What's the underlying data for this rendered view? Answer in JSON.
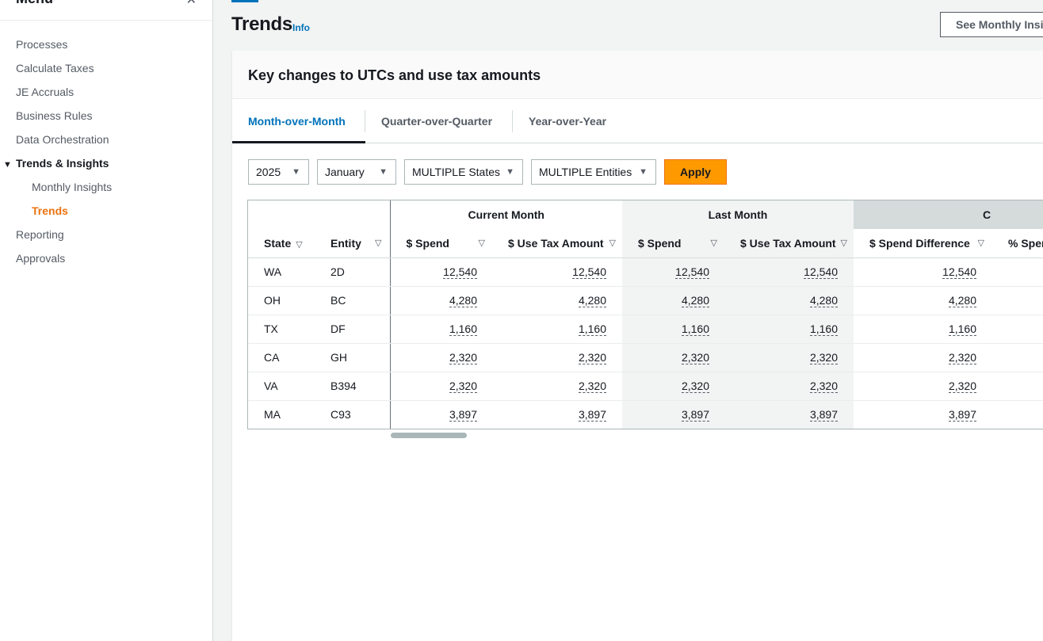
{
  "sidebar": {
    "title": "Menu",
    "close_icon": "close-icon",
    "items": [
      {
        "label": "Processes"
      },
      {
        "label": "Calculate Taxes"
      },
      {
        "label": "JE Accruals"
      },
      {
        "label": "Business Rules"
      },
      {
        "label": "Data Orchestration"
      },
      {
        "label": "Trends & Insights",
        "expanded": true
      },
      {
        "label": "Monthly Insights"
      },
      {
        "label": "Trends",
        "active": true
      },
      {
        "label": "Reporting"
      },
      {
        "label": "Approvals"
      }
    ]
  },
  "header": {
    "title": "Trends",
    "info": "Info",
    "see_button": "See Monthly Insights"
  },
  "container": {
    "title": "Key changes to UTCs and use tax amounts"
  },
  "tabs": [
    {
      "label": "Month-over-Month",
      "active": true
    },
    {
      "label": "Quarter-over-Quarter"
    },
    {
      "label": "Year-over-Year"
    }
  ],
  "filters": {
    "year": "2025",
    "month": "January",
    "states": "MULTIPLE States",
    "entities": "MULTIPLE Entities",
    "apply": "Apply"
  },
  "table": {
    "groups": {
      "current": "Current Month",
      "last": "Last Month",
      "diff": "C"
    },
    "columns": [
      "State",
      "Entity",
      "$ Spend",
      "$ Use Tax Amount",
      "$ Spend",
      "$ Use Tax Amount",
      "$ Spend Difference",
      "% Sper"
    ],
    "rows": [
      [
        "WA",
        "2D",
        "12,540",
        "12,540",
        "12,540",
        "12,540",
        "12,540"
      ],
      [
        "OH",
        "BC",
        "4,280",
        "4,280",
        "4,280",
        "4,280",
        "4,280"
      ],
      [
        "TX",
        "DF",
        "1,160",
        "1,160",
        "1,160",
        "1,160",
        "1,160"
      ],
      [
        "CA",
        "GH",
        "2,320",
        "2,320",
        "2,320",
        "2,320",
        "2,320"
      ],
      [
        "VA",
        "B394",
        "2,320",
        "2,320",
        "2,320",
        "2,320",
        "2,320"
      ],
      [
        "MA",
        "C93",
        "3,897",
        "3,897",
        "3,897",
        "3,897",
        "3,897"
      ]
    ]
  },
  "colors": {
    "accent": "#0073bb",
    "active_nav": "#ec7211",
    "primary_button": "#ff9900"
  }
}
